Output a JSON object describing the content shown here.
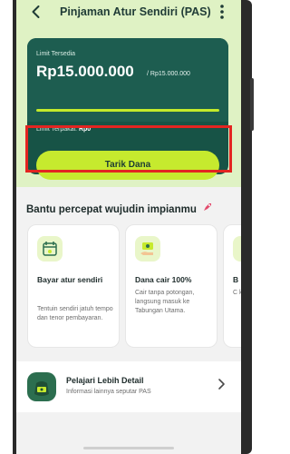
{
  "header": {
    "back_icon": "chevron-left-icon",
    "title": "Pinjaman Atur Sendiri (PAS)",
    "menu_icon": "kebab-menu-icon"
  },
  "limit_card": {
    "available_label": "Limit Tersedia",
    "available_value": "Rp15.000.000",
    "total_value": "/ Rp15.000.000",
    "usage_fraction": 1.0,
    "used_label": "Limit Terpakai:",
    "used_value": "Rp0",
    "cta_label": "Tarik Dana"
  },
  "section": {
    "title": "Bantu percepat wujudin impianmu",
    "title_icon": "rocket-icon"
  },
  "benefits": [
    {
      "icon": "calendar-icon",
      "title": "Bayar atur sendiri",
      "desc": "Tentuin sendiri jatuh tempo dan tenor pembayaran."
    },
    {
      "icon": "money-hand-icon",
      "title": "Dana cair 100%",
      "desc": "Cair tanpa potongan, langsung masuk ke Tabungan Utama."
    },
    {
      "icon": "more-benefit-icon",
      "title": "B",
      "desc": "C k b"
    }
  ],
  "learn_more": {
    "icon": "money-bag-icon",
    "title": "Pelajari Lebih Detail",
    "subtitle": "Informasi lainnya seputar PAS",
    "chevron_icon": "chevron-right-icon"
  },
  "colors": {
    "hero_bg": "#dff2c4",
    "card_bg": "#175346",
    "accent": "#c6ea2e",
    "highlight": "#e32521"
  }
}
